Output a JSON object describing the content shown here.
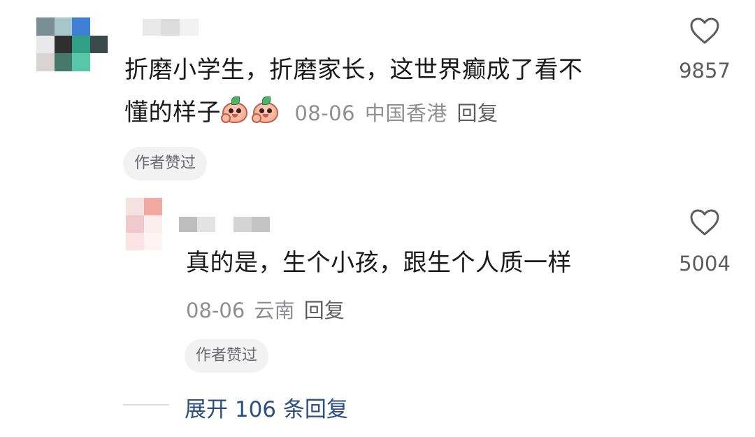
{
  "colors": {
    "text": "#1a1a1a",
    "meta": "#8e8e93",
    "expand_link": "#2c4f84",
    "pill_bg": "#f2f2f2"
  },
  "comment": {
    "line1": "折磨小学生，折磨家长，这世界癫成了看不",
    "line2": "懂的样子",
    "emoji_count": 2,
    "date": "08-06",
    "location": "中国香港",
    "reply_label": "回复",
    "likes": "9857",
    "author_liked_badge": "作者赞过",
    "heart_icon": "heart-outline-icon"
  },
  "reply": {
    "text": "真的是，生个小孩，跟生个人质一样",
    "date": "08-06",
    "location": "云南",
    "reply_label": "回复",
    "likes": "5004",
    "author_liked_badge": "作者赞过",
    "heart_icon": "heart-outline-icon"
  },
  "expand": {
    "label": "展开 106 条回复"
  }
}
